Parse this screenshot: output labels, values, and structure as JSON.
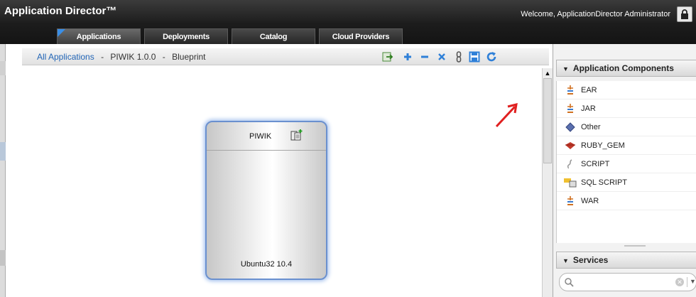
{
  "header": {
    "title": "Application Director™",
    "welcome": "Welcome, ApplicationDirector Administrator"
  },
  "tabs": [
    {
      "label": "Applications",
      "active": true
    },
    {
      "label": "Deployments",
      "active": false
    },
    {
      "label": "Catalog",
      "active": false
    },
    {
      "label": "Cloud Providers",
      "active": false
    }
  ],
  "breadcrumb": {
    "root": "All Applications",
    "sep": "-",
    "app": "PIWIK 1.0.0",
    "view": "Blueprint"
  },
  "toolbar": {
    "icons": [
      "export-icon",
      "add-icon",
      "remove-icon",
      "delete-icon",
      "link-icon",
      "save-icon",
      "refresh-icon"
    ]
  },
  "node": {
    "name": "PIWIK",
    "os": "Ubuntu32 10.4"
  },
  "components_panel": {
    "title": "Application Components",
    "items": [
      "EAR",
      "JAR",
      "Other",
      "RUBY_GEM",
      "SCRIPT",
      "SQL SCRIPT",
      "WAR"
    ]
  },
  "services_panel": {
    "title": "Services",
    "search_value": ""
  },
  "colors": {
    "accent": "#2366b7",
    "node_border": "#6a90cf",
    "annotation": "#e02020"
  }
}
